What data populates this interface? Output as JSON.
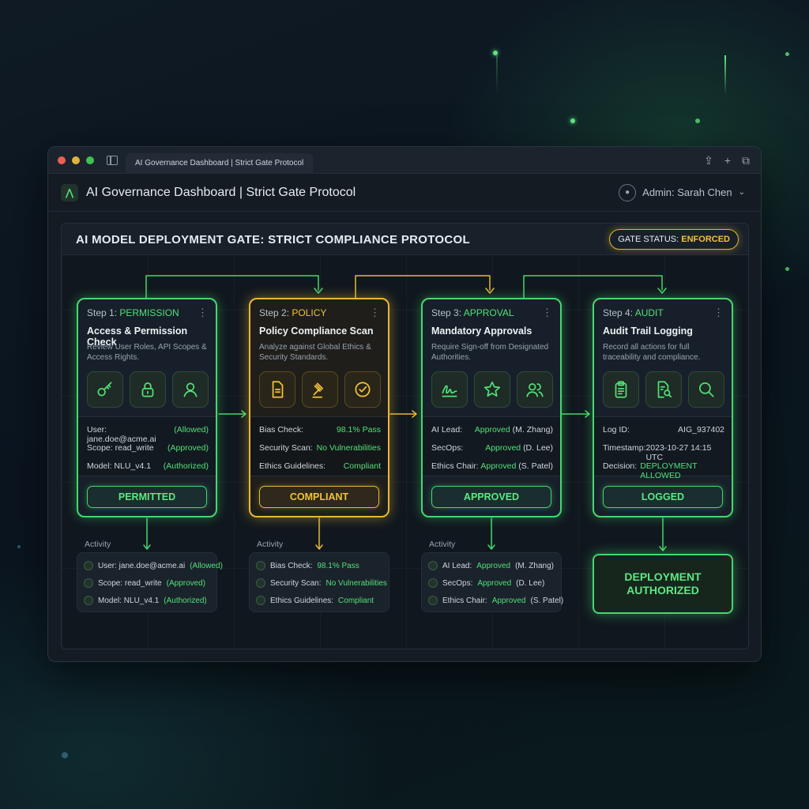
{
  "browser": {
    "tab_title": "AI Governance Dashboard | Strict Gate Protocol"
  },
  "header": {
    "app_title": "AI Governance Dashboard | Strict Gate Protocol",
    "admin_label": "Admin: Sarah Chen"
  },
  "panel": {
    "title": "AI MODEL DEPLOYMENT GATE: STRICT COMPLIANCE PROTOCOL",
    "gate_label": "GATE STATUS:",
    "gate_value": "ENFORCED"
  },
  "steps": [
    {
      "step_prefix": "Step 1:",
      "step_name": "PERMISSION",
      "title": "Access & Permission Check",
      "desc": "Review User Roles, API Scopes & Access Rights.",
      "icons": [
        "key-icon",
        "lock-icon",
        "user-icon"
      ],
      "rows": [
        {
          "k": "User: jane.doe@acme.ai",
          "v": "(Allowed)"
        },
        {
          "k": "Scope: read_write",
          "v": "(Approved)"
        },
        {
          "k": "Model: NLU_v4.1",
          "v": "(Authorized)"
        }
      ],
      "button": "PERMITTED",
      "activity": [
        {
          "k": "User: jane.doe@acme.ai",
          "v": "(Allowed)"
        },
        {
          "k": "Scope: read_write",
          "v": "(Approved)"
        },
        {
          "k": "Model: NLU_v4.1",
          "v": "(Authorized)"
        }
      ]
    },
    {
      "step_prefix": "Step 2:",
      "step_name": "POLICY",
      "title": "Policy Compliance Scan",
      "desc": "Analyze against Global Ethics & Security Standards.",
      "icons": [
        "document-icon",
        "gavel-icon",
        "check-circle-icon"
      ],
      "rows": [
        {
          "k": "Bias Check:",
          "v": "98.1% Pass"
        },
        {
          "k": "Security Scan:",
          "v": "No Vulnerabilities"
        },
        {
          "k": "Ethics Guidelines:",
          "v": "Compliant"
        }
      ],
      "button": "COMPLIANT",
      "activity": [
        {
          "k": "Bias Check:",
          "v": "98.1% Pass"
        },
        {
          "k": "Security Scan:",
          "v": "No Vulnerabilities"
        },
        {
          "k": "Ethics Guidelines:",
          "v": "Compliant"
        }
      ]
    },
    {
      "step_prefix": "Step 3:",
      "step_name": "APPROVAL",
      "title": "Mandatory Approvals",
      "desc": "Require Sign-off from Designated Authorities.",
      "icons": [
        "signature-icon",
        "star-icon",
        "users-icon"
      ],
      "rows": [
        {
          "k": "AI Lead:",
          "v": "Approved",
          "p": "(M. Zhang)"
        },
        {
          "k": "SecOps:",
          "v": "Approved",
          "p": "(D. Lee)"
        },
        {
          "k": "Ethics Chair:",
          "v": "Approved",
          "p": "(S. Patel)"
        }
      ],
      "button": "APPROVED",
      "activity": [
        {
          "k": "AI Lead:",
          "v": "Approved",
          "p": "(M. Zhang)"
        },
        {
          "k": "SecOps:",
          "v": "Approved",
          "p": "(D. Lee)"
        },
        {
          "k": "Ethics Chair:",
          "v": "Approved",
          "p": "(S. Patel)"
        }
      ]
    },
    {
      "step_prefix": "Step 4:",
      "step_name": "AUDIT",
      "title": "Audit Trail Logging",
      "desc": "Record all actions for full traceability and compliance.",
      "icons": [
        "clipboard-icon",
        "document-search-icon",
        "search-icon"
      ],
      "rows": [
        {
          "k": "Log ID:",
          "v": "AIG_937402"
        },
        {
          "k": "Timestamp:",
          "v": "2023-10-27 14:15 UTC"
        },
        {
          "k": "Decision:",
          "v": "DEPLOYMENT ALLOWED"
        }
      ],
      "button": "LOGGED"
    }
  ],
  "activity_label": "Activity",
  "deployment": {
    "line1": "DEPLOYMENT",
    "line2": "AUTHORIZED"
  },
  "colors": {
    "accent_green": "#47d66e",
    "accent_amber": "#e6b83a",
    "background": "#0f1a24"
  }
}
